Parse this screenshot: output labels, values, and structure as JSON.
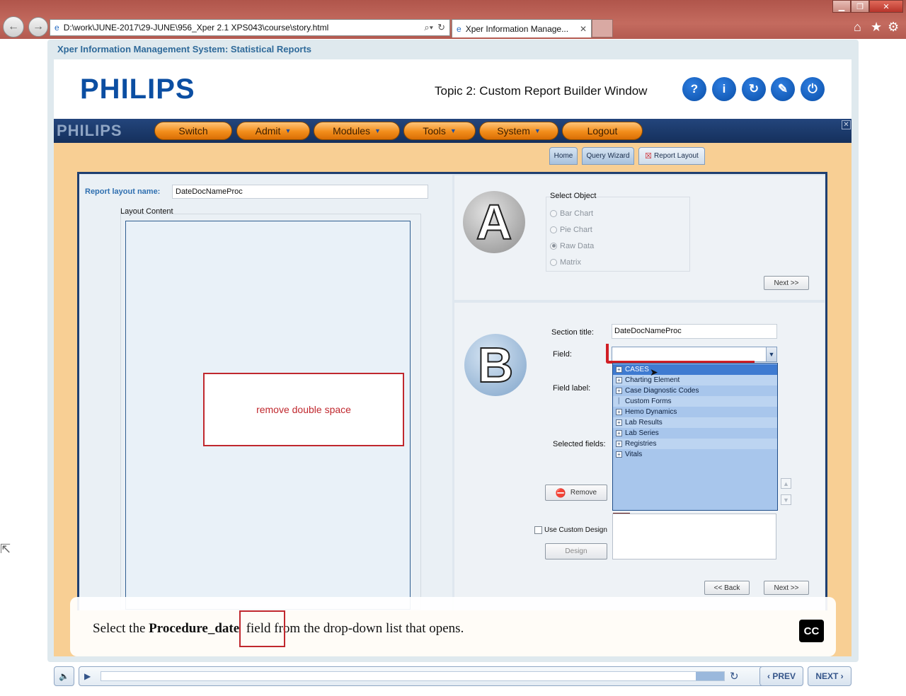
{
  "browser": {
    "address": "D:\\work\\JUNE-2017\\29-JUNE\\956_Xper 2.1 XPS043\\course\\story.html",
    "tab_title": "Xper Information Manage...",
    "window_controls": [
      "minimize-icon",
      "restore-icon",
      "close-icon"
    ],
    "toolbar_icons": [
      "home-icon",
      "star-icon",
      "gear-icon"
    ]
  },
  "course": {
    "title": "Xper Information Management System: Statistical Reports",
    "logo": "PHILIPS",
    "topic": "Topic 2: Custom Report Builder Window",
    "controls": [
      "?",
      "i",
      "↻",
      "✎",
      "⏻"
    ]
  },
  "app": {
    "logo": "PHILIPS",
    "menu": [
      {
        "label": "Switch",
        "has_arrow": false
      },
      {
        "label": "Admit",
        "has_arrow": true
      },
      {
        "label": "Modules",
        "has_arrow": true
      },
      {
        "label": "Tools",
        "has_arrow": true
      },
      {
        "label": "System",
        "has_arrow": true
      },
      {
        "label": "Logout",
        "has_arrow": false
      }
    ],
    "subtabs": [
      "Home",
      "Query Wizard",
      "Report Layout"
    ],
    "left": {
      "layout_name_label": "Report layout name:",
      "layout_name_value": "DateDocNameProc",
      "layout_content_label": "Layout Content"
    },
    "remark": "remove double space",
    "sectionA": {
      "letter": "A",
      "select_object_label": "Select Object",
      "options": [
        {
          "label": "Bar Chart",
          "checked": false
        },
        {
          "label": "Pie Chart",
          "checked": false
        },
        {
          "label": "Raw Data",
          "checked": true
        },
        {
          "label": "Matrix",
          "checked": false
        }
      ],
      "next": "Next >>"
    },
    "sectionB": {
      "letter": "B",
      "section_title_label": "Section title:",
      "section_title_value": "DateDocNameProc",
      "field_label": "Field:",
      "field_label_label": "Field label:",
      "selected_fields_label": "Selected fields:",
      "remove": "Remove",
      "use_custom_design": "Use Custom Design",
      "design": "Design",
      "back": "<< Back",
      "next": "Next >>",
      "dropdown_items": [
        {
          "label": "CASES",
          "expand": true,
          "selected": true
        },
        {
          "label": "Charting Element",
          "expand": true,
          "selected": false
        },
        {
          "label": "Case Diagnostic Codes",
          "expand": true,
          "selected": false
        },
        {
          "label": "Custom Forms",
          "expand": false,
          "selected": false
        },
        {
          "label": "Hemo Dynamics",
          "expand": true,
          "selected": false
        },
        {
          "label": "Lab Results",
          "expand": true,
          "selected": false
        },
        {
          "label": "Lab Series",
          "expand": true,
          "selected": false
        },
        {
          "label": "Registries",
          "expand": true,
          "selected": false
        },
        {
          "label": "Vitals",
          "expand": true,
          "selected": false
        }
      ]
    }
  },
  "caption": {
    "pre": "Select the ",
    "bold": "Procedure_date",
    "post": "  field from the drop-down list that opens.",
    "cc": "CC"
  },
  "player": {
    "prev": "PREV",
    "next": "NEXT",
    "progress": 0.95
  }
}
